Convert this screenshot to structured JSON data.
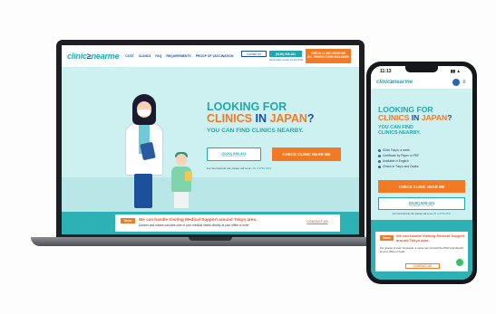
{
  "brand": {
    "logo_left": "clinic",
    "logo_mid": "≥",
    "logo_right": "nearme"
  },
  "nav": {
    "links": [
      "COST",
      "CLINICS",
      "FAQ",
      "REQUIREMENTS",
      "PROOF OF VACCINATION"
    ],
    "contact_label": "Contact Us",
    "phone_label": "(0120) 939-421",
    "hours_label": "Reservation Center 10:00-22:00",
    "cta_line1": "CHECK CLINIC NEAR ME",
    "cta_line2": "ALL PREFECTURE INCLUDED"
  },
  "hero": {
    "title_line1": "LOOKING FOR",
    "title_clinics": "CLINICS",
    "title_in": " IN ",
    "title_japan": "JAPAN",
    "title_q": "?",
    "subtitle": "YOU CAN FIND CLINICS NEARBY.",
    "phone_number": "(0120) 939-421",
    "phone_note": "RESERVATION CENTER",
    "cta": "CHECK CLINIC NEAR ME",
    "intl_text": "For international call, please call us at ",
    "intl_number": "+81 3-6758-2502"
  },
  "notice": {
    "badge": "News",
    "title": "We can handle Visiting Medical Support around Tokyo area.",
    "body": "Doctors and nurses can take care of your medical needs directly at your office or hotel",
    "link": "CONTACT US"
  },
  "phone": {
    "status_time": "11:13",
    "status_icons": "▮▮ ▲",
    "menu_icon": "≡",
    "title_line1": "LOOKING FOR",
    "title_clinics": "CLINICS",
    "title_in": " IN ",
    "title_japan": "JAPAN",
    "title_q": "?",
    "subtitle_line1": "YOU CAN FIND",
    "subtitle_line2": "CLINICS NEARBY.",
    "features": [
      "Clinic Tokyo, a week",
      "Certificate by Paper or PDF",
      "Available in English",
      "Clinics in Tokyo and Osaka"
    ],
    "cta": "CHECK CLINIC NEAR ME",
    "phone_number": "(0120) 939-421",
    "phone_note": "RESERVATION CENTER",
    "intl_text": "For international call, please call us at ",
    "intl_number": "+81 3-6758-2502",
    "notice_badge": "News",
    "notice_title": "We can handle Visiting Medical Support around Tokyo area.",
    "notice_body": "For groups of over 10 people, a nurse can conduct the PCR test directly at your office or hotel.",
    "notice_link": "CONTACT US"
  },
  "colors": {
    "teal": "#20a9ad",
    "orange": "#f27a25",
    "navy": "#1c4f9c",
    "hero_bg": "#cdf0f0"
  }
}
